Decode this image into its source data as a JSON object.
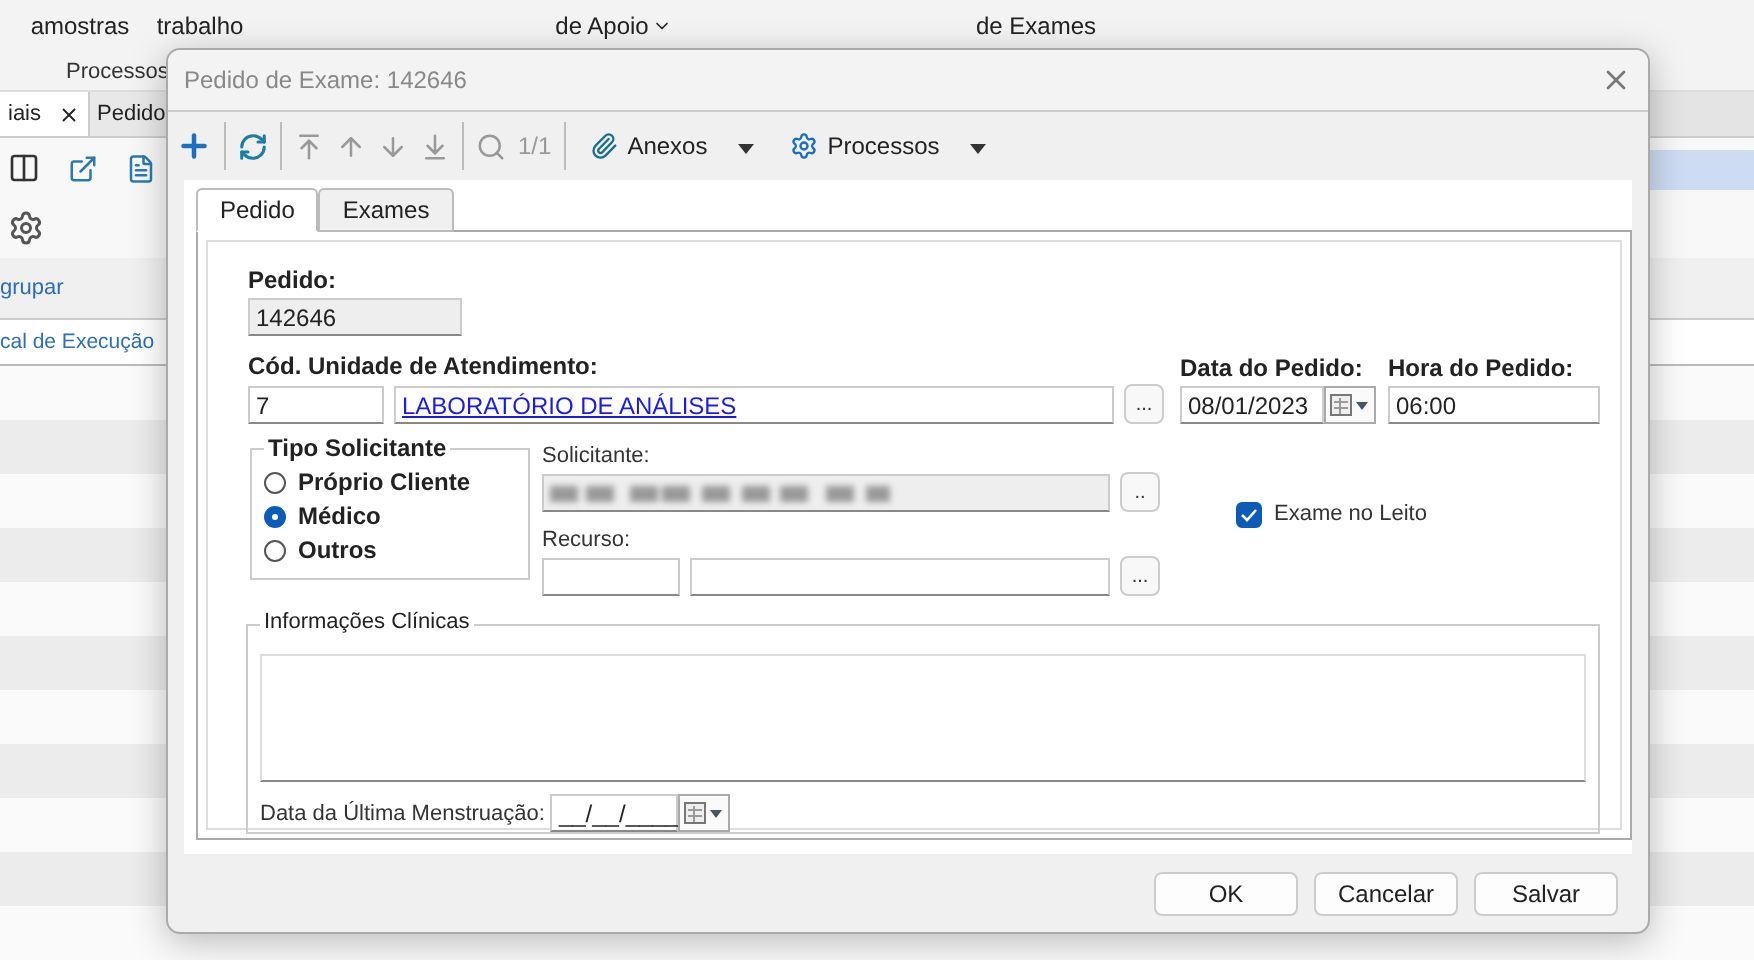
{
  "background_app": {
    "ribbon_items": [
      {
        "label": "amostras",
        "dropdown": false
      },
      {
        "label": "trabalho",
        "dropdown": false
      },
      {
        "label": "de Apoio",
        "dropdown": true
      },
      {
        "label": "de Exames",
        "dropdown": false
      }
    ],
    "ribbon_group": "Processos",
    "tabs": [
      {
        "label": "iais",
        "closable": true
      },
      {
        "label": "Pedido",
        "closable": false
      }
    ],
    "group_label": "grupar",
    "column_header": "cal de Execução"
  },
  "dialog": {
    "title": "Pedido de Exame: 142646",
    "toolbar": {
      "pager": "1/1",
      "menus": [
        {
          "label": "Anexos",
          "kind": "attach"
        },
        {
          "label": "Processos",
          "kind": "gear"
        }
      ]
    },
    "tabs": [
      {
        "label": "Pedido",
        "selected": true
      },
      {
        "label": "Exames",
        "selected": false
      }
    ],
    "form": {
      "pedido": {
        "label": "Pedido:",
        "value": "142646"
      },
      "unidade": {
        "label": "Cód. Unidade de Atendimento:",
        "code": "7",
        "name": "LABORATÓRIO DE ANÁLISES",
        "browse": "..."
      },
      "data": {
        "label": "Data do Pedido:",
        "value": "08/01/2023"
      },
      "hora": {
        "label": "Hora do Pedido:",
        "value": "06:00"
      },
      "tipo": {
        "legend": "Tipo Solicitante",
        "options": [
          {
            "label": "Próprio Cliente",
            "selected": false
          },
          {
            "label": "Médico",
            "selected": true
          },
          {
            "label": "Outros",
            "selected": false
          }
        ]
      },
      "solicitante": {
        "label": "Solicitante:",
        "browse": ".."
      },
      "recurso": {
        "label": "Recurso:",
        "browse": "..."
      },
      "exame_no_leito": {
        "label": "Exame no Leito",
        "checked": true
      },
      "info_clinicas": {
        "legend": "Informações Clínicas"
      },
      "dum": {
        "label": "Data da Última Menstruação:",
        "value": "__/__/____"
      }
    },
    "buttons": [
      "OK",
      "Cancelar",
      "Salvar"
    ]
  }
}
